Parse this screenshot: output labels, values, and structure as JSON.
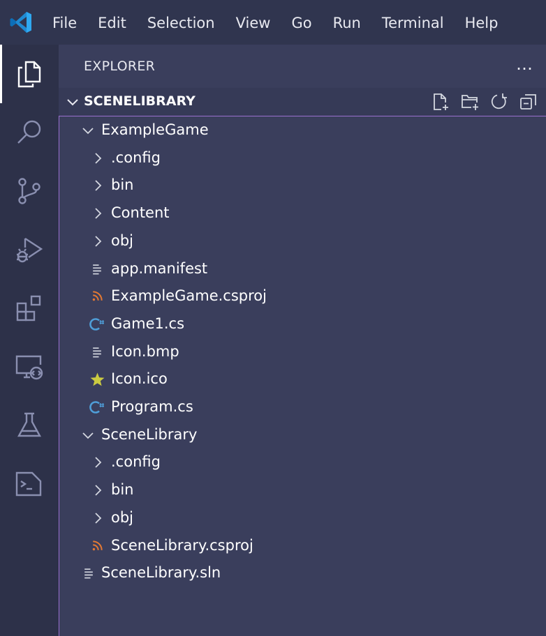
{
  "menu": [
    "File",
    "Edit",
    "Selection",
    "View",
    "Go",
    "Run",
    "Terminal",
    "Help"
  ],
  "activity_bar": [
    "files-icon",
    "search-icon",
    "source-control-icon",
    "run-debug-icon",
    "extensions-icon",
    "remote-explorer-icon",
    "testing-icon",
    "terminal-icon"
  ],
  "sidebar": {
    "title": "EXPLORER",
    "more": "…",
    "section_title": "SCENELIBRARY",
    "section_actions": [
      "new-file-icon",
      "new-folder-icon",
      "refresh-icon",
      "collapse-all-icon"
    ]
  },
  "tree": [
    {
      "label": "ExampleGame",
      "kind": "folder",
      "open": true,
      "depth": 0
    },
    {
      "label": ".config",
      "kind": "folder",
      "open": false,
      "depth": 1
    },
    {
      "label": "bin",
      "kind": "folder",
      "open": false,
      "depth": 1
    },
    {
      "label": "Content",
      "kind": "folder",
      "open": false,
      "depth": 1
    },
    {
      "label": "obj",
      "kind": "folder",
      "open": false,
      "depth": 1
    },
    {
      "label": "app.manifest",
      "kind": "text",
      "depth": 1
    },
    {
      "label": "ExampleGame.csproj",
      "kind": "rss",
      "depth": 1
    },
    {
      "label": "Game1.cs",
      "kind": "csharp",
      "depth": 1
    },
    {
      "label": "Icon.bmp",
      "kind": "text",
      "depth": 1
    },
    {
      "label": "Icon.ico",
      "kind": "star",
      "depth": 1
    },
    {
      "label": "Program.cs",
      "kind": "csharp",
      "depth": 1
    },
    {
      "label": "SceneLibrary",
      "kind": "folder",
      "open": true,
      "depth": 0
    },
    {
      "label": ".config",
      "kind": "folder",
      "open": false,
      "depth": 1
    },
    {
      "label": "bin",
      "kind": "folder",
      "open": false,
      "depth": 1
    },
    {
      "label": "obj",
      "kind": "folder",
      "open": false,
      "depth": 1
    },
    {
      "label": "SceneLibrary.csproj",
      "kind": "rss",
      "depth": 1
    },
    {
      "label": "SceneLibrary.sln",
      "kind": "text",
      "depth": 0
    }
  ],
  "colors": {
    "rss": "#e37933",
    "csharp": "#4f9ed8",
    "star": "#cbcb41",
    "text": "#d4d7e0",
    "accent_border": "#9a6fcf"
  }
}
